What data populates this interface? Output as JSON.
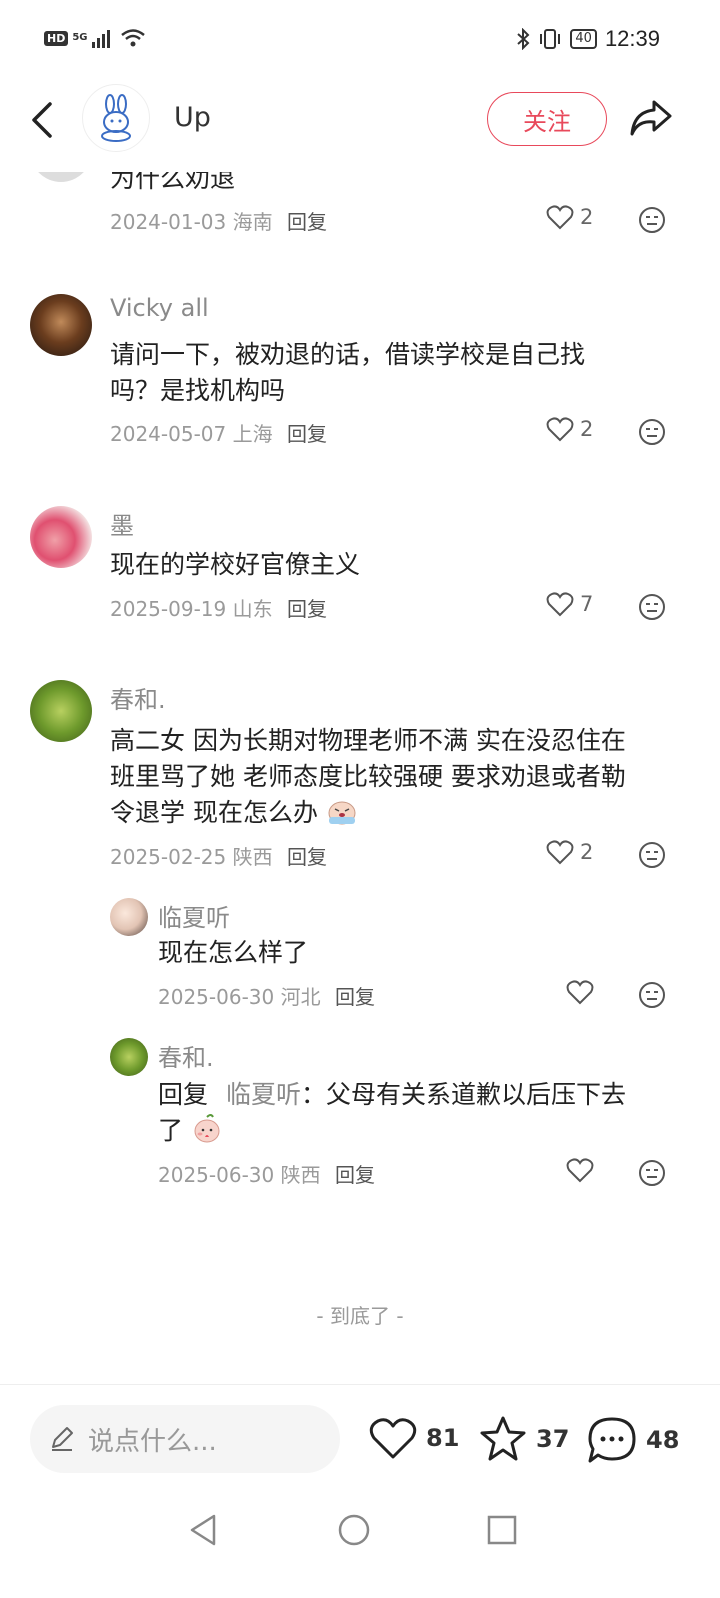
{
  "status_bar": {
    "left_badge": "HD",
    "network": "5G",
    "bluetooth_icon": "bluetooth-icon",
    "vibrate_icon": "vibrate-icon",
    "battery": "40",
    "time": "12:39"
  },
  "header": {
    "author_name": "Up",
    "follow_label": "关注"
  },
  "comments": [
    {
      "text": "为什么劝退",
      "date": "2024-01-03",
      "location": "海南",
      "reply_label": "回复",
      "likes": "2"
    },
    {
      "username": "Vicky all",
      "text_line1": "请问一下，被劝退的话，借读学校是自己找",
      "text_line2": "吗？是找机构吗",
      "date": "2024-05-07",
      "location": "上海",
      "reply_label": "回复",
      "likes": "2"
    },
    {
      "username": "墨",
      "text": "现在的学校好官僚主义",
      "date": "2025-09-19",
      "location": "山东",
      "reply_label": "回复",
      "likes": "7"
    },
    {
      "username": "春和.",
      "text_line1": "高二女 因为长期对物理老师不满 实在没忍住在",
      "text_line2": "班里骂了她 老师态度比较强硬 要求劝退或者勒",
      "text_line3": "令退学 现在怎么办",
      "date": "2025-02-25",
      "location": "陕西",
      "reply_label": "回复",
      "likes": "2",
      "replies": [
        {
          "username": "临夏听",
          "text": "现在怎么样了",
          "date": "2025-06-30",
          "location": "河北",
          "reply_label": "回复"
        },
        {
          "username": "春和.",
          "reply_prefix": "回复",
          "mention": "临夏听",
          "text_line1": "：父母有关系道歉以后压下去",
          "text_line2": "了",
          "date": "2025-06-30",
          "location": "陕西",
          "reply_label": "回复"
        }
      ]
    }
  ],
  "end_text": "- 到底了 -",
  "bottom": {
    "input_placeholder": "说点什么...",
    "likes": "81",
    "favorites": "37",
    "comments": "48"
  },
  "colors": {
    "accent": "#e8495b",
    "muted_text": "#9a9a9a"
  }
}
